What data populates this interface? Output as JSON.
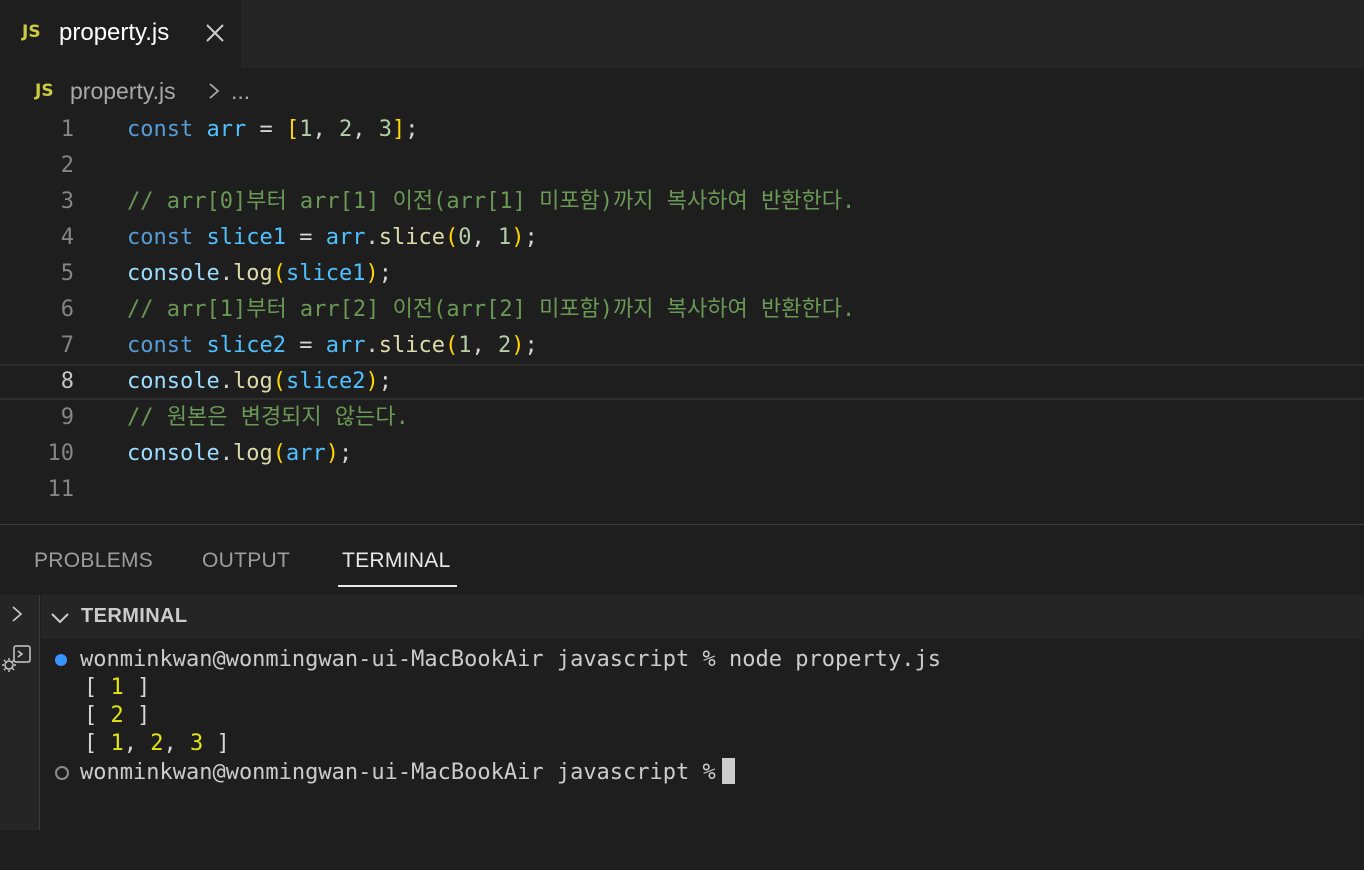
{
  "tab": {
    "badge": "JS",
    "title": "property.js"
  },
  "breadcrumb": {
    "badge": "JS",
    "file": "property.js",
    "more": "..."
  },
  "code": [
    {
      "n": "1",
      "tokens": [
        [
          "kw",
          "const"
        ],
        [
          "op",
          " "
        ],
        [
          "vr",
          "arr"
        ],
        [
          "op",
          " = "
        ],
        [
          "b1",
          "["
        ],
        [
          "nm",
          "1"
        ],
        [
          "op",
          ", "
        ],
        [
          "nm",
          "2"
        ],
        [
          "op",
          ", "
        ],
        [
          "nm",
          "3"
        ],
        [
          "b1",
          "]"
        ],
        [
          "op",
          ";"
        ]
      ]
    },
    {
      "n": "2",
      "tokens": []
    },
    {
      "n": "3",
      "tokens": [
        [
          "cm",
          "// arr[0]부터 arr[1] 이전(arr[1] 미포함)까지 복사하여 반환한다."
        ]
      ]
    },
    {
      "n": "4",
      "tokens": [
        [
          "kw",
          "const"
        ],
        [
          "op",
          " "
        ],
        [
          "vr",
          "slice1"
        ],
        [
          "op",
          " = "
        ],
        [
          "vr",
          "arr"
        ],
        [
          "op",
          "."
        ],
        [
          "fn",
          "slice"
        ],
        [
          "b1",
          "("
        ],
        [
          "nm",
          "0"
        ],
        [
          "op",
          ", "
        ],
        [
          "nm",
          "1"
        ],
        [
          "b1",
          ")"
        ],
        [
          "op",
          ";"
        ]
      ]
    },
    {
      "n": "5",
      "tokens": [
        [
          "pl",
          "console"
        ],
        [
          "op",
          "."
        ],
        [
          "fn",
          "log"
        ],
        [
          "b1",
          "("
        ],
        [
          "vr",
          "slice1"
        ],
        [
          "b1",
          ")"
        ],
        [
          "op",
          ";"
        ]
      ]
    },
    {
      "n": "6",
      "tokens": [
        [
          "cm",
          "// arr[1]부터 arr[2] 이전(arr[2] 미포함)까지 복사하여 반환한다."
        ]
      ]
    },
    {
      "n": "7",
      "tokens": [
        [
          "kw",
          "const"
        ],
        [
          "op",
          " "
        ],
        [
          "vr",
          "slice2"
        ],
        [
          "op",
          " = "
        ],
        [
          "vr",
          "arr"
        ],
        [
          "op",
          "."
        ],
        [
          "fn",
          "slice"
        ],
        [
          "b1",
          "("
        ],
        [
          "nm",
          "1"
        ],
        [
          "op",
          ", "
        ],
        [
          "nm",
          "2"
        ],
        [
          "b1",
          ")"
        ],
        [
          "op",
          ";"
        ]
      ]
    },
    {
      "n": "8",
      "tokens": [
        [
          "pl",
          "console"
        ],
        [
          "op",
          "."
        ],
        [
          "fn",
          "log"
        ],
        [
          "b1",
          "("
        ],
        [
          "vr",
          "slice2"
        ],
        [
          "b1",
          ")"
        ],
        [
          "op",
          ";"
        ]
      ],
      "current": true
    },
    {
      "n": "9",
      "tokens": [
        [
          "cm",
          "// 원본은 변경되지 않는다."
        ]
      ]
    },
    {
      "n": "10",
      "tokens": [
        [
          "pl",
          "console"
        ],
        [
          "op",
          "."
        ],
        [
          "fn",
          "log"
        ],
        [
          "b1",
          "("
        ],
        [
          "vr",
          "arr"
        ],
        [
          "b1",
          ")"
        ],
        [
          "op",
          ";"
        ]
      ]
    },
    {
      "n": "11",
      "tokens": []
    }
  ],
  "panel": {
    "tabs": [
      "PROBLEMS",
      "OUTPUT",
      "TERMINAL"
    ],
    "active_tab": "TERMINAL",
    "terminal_header": "TERMINAL"
  },
  "terminal": {
    "prompt1": "wonminkwan@wonmingwan-ui-MacBookAir javascript % node property.js",
    "outputs": [
      [
        [
          "op",
          "[ "
        ],
        [
          "tnum",
          "1"
        ],
        [
          "op",
          " ]"
        ]
      ],
      [
        [
          "op",
          "[ "
        ],
        [
          "tnum",
          "2"
        ],
        [
          "op",
          " ]"
        ]
      ],
      [
        [
          "op",
          "[ "
        ],
        [
          "tnum",
          "1"
        ],
        [
          "op",
          ", "
        ],
        [
          "tnum",
          "2"
        ],
        [
          "op",
          ", "
        ],
        [
          "tnum",
          "3"
        ],
        [
          "op",
          " ]"
        ]
      ]
    ],
    "prompt2": "wonminkwan@wonmingwan-ui-MacBookAir javascript %"
  },
  "colors": {
    "js_badge": "#cbcb41",
    "keyword": "#569cd6",
    "variable": "#4fc1ff",
    "function": "#dcdcaa",
    "number": "#b5cea8",
    "comment": "#6a9955",
    "bracket": "#ffd700",
    "terminal_number": "#e5e510",
    "success_dot": "#3794ff"
  }
}
